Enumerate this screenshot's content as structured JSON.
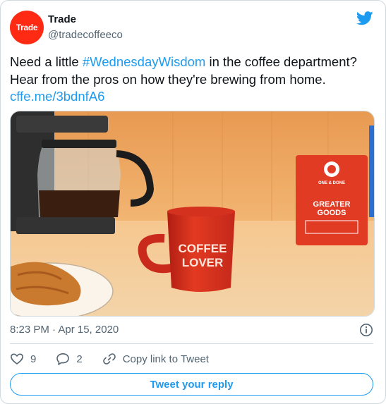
{
  "author": {
    "name": "Trade",
    "handle": "@tradecoffeeco",
    "avatar_text": "Trade",
    "avatar_color": "#ff2a14"
  },
  "tweet": {
    "text_before": "Need a little ",
    "hashtag": "#WednesdayWisdom",
    "text_after": " in the coffee department? Hear from the pros on how they're brewing from home. ",
    "link": "cffe.me/3bdnfA6"
  },
  "media": {
    "mug_text_line1": "COFFEE",
    "mug_text_line2": "LOVER",
    "bag_brand_line1": "GREATER",
    "bag_brand_line2": "GOODS",
    "bag_top_text": "ONE & DONE"
  },
  "timestamp": "8:23 PM · Apr 15, 2020",
  "actions": {
    "likes": "9",
    "replies": "2",
    "copy_link": "Copy link to Tweet"
  },
  "reply_button": "Tweet your reply",
  "icons": {
    "brand": "twitter-bird-icon",
    "info": "info-icon",
    "like": "heart-icon",
    "reply": "reply-bubble-icon",
    "copy": "link-icon"
  },
  "colors": {
    "accent": "#1d9bf0",
    "secondary_text": "#536471",
    "border": "#cfd9de"
  }
}
